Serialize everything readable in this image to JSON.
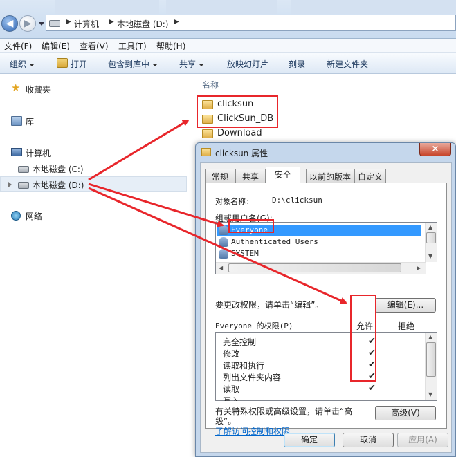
{
  "address": {
    "crumbs": [
      "计算机",
      "本地磁盘 (D:)"
    ]
  },
  "menu": [
    "文件(F)",
    "编辑(E)",
    "查看(V)",
    "工具(T)",
    "帮助(H)"
  ],
  "commands": {
    "organize": "组织",
    "open": "打开",
    "include": "包含到库中",
    "share": "共享",
    "slideshow": "放映幻灯片",
    "burn": "刻录",
    "new_folder": "新建文件夹"
  },
  "nav": {
    "favorites": "收藏夹",
    "libraries": "库",
    "computer": "计算机",
    "drive_c": "本地磁盘 (C:)",
    "drive_d": "本地磁盘 (D:)",
    "network": "网络"
  },
  "files": {
    "column_name": "名称",
    "items": [
      "clicksun",
      "ClickSun_DB",
      "Download"
    ]
  },
  "dialog": {
    "title": "clicksun 属性",
    "close": "×",
    "tabs": [
      "常规",
      "共享",
      "安全",
      "以前的版本",
      "自定义"
    ],
    "object_label": "对象名称:",
    "object_value": "D:\\clicksun",
    "group_label": "组或用户名(G):",
    "users": [
      "Everyone",
      "Authenticated Users",
      "SYSTEM"
    ],
    "edit_hint": "要更改权限，请单击“编辑”。",
    "edit_button": "编辑(E)...",
    "perm_title": "Everyone 的权限(P)",
    "allow": "允许",
    "deny": "拒绝",
    "permissions": [
      "完全控制",
      "修改",
      "读取和执行",
      "列出文件夹内容",
      "读取",
      "写入"
    ],
    "checkmark": "✔",
    "advanced_hint": "有关特殊权限或高级设置，请单击“高级”。",
    "advanced_button": "高级(V)",
    "link": "了解访问控制和权限",
    "ok": "确定",
    "cancel": "取消",
    "apply": "应用(A)"
  }
}
